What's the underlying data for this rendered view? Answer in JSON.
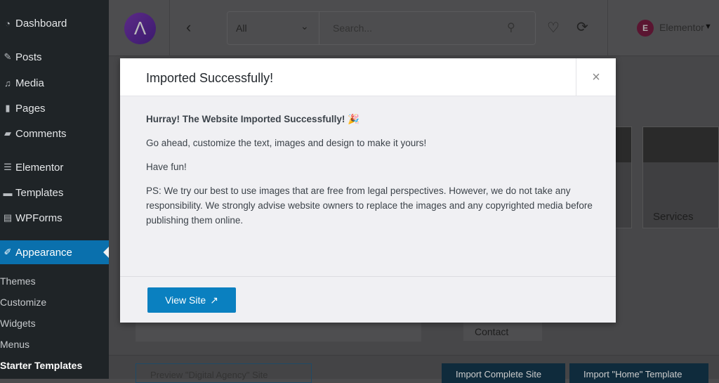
{
  "sidebar": {
    "items": [
      {
        "label": "Dashboard",
        "icon": "dashboard-icon"
      },
      {
        "label": "Posts",
        "icon": "pin-icon"
      },
      {
        "label": "Media",
        "icon": "media-icon"
      },
      {
        "label": "Pages",
        "icon": "pages-icon"
      },
      {
        "label": "Comments",
        "icon": "comment-icon"
      },
      {
        "label": "Elementor",
        "icon": "elementor-icon"
      },
      {
        "label": "Templates",
        "icon": "folder-icon"
      },
      {
        "label": "WPForms",
        "icon": "forms-icon"
      },
      {
        "label": "Appearance",
        "icon": "brush-icon"
      }
    ],
    "submenu": [
      "Themes",
      "Customize",
      "Widgets",
      "Menus",
      "Starter Templates"
    ]
  },
  "topbar": {
    "filter": "All",
    "search_placeholder": "Search...",
    "builder": "Elementor"
  },
  "background": {
    "thumb_label": "Services",
    "contact_label": "Contact",
    "buttons": [
      "Preview \"Digital Agency\" Site",
      "Import Complete Site",
      "Import \"Home\" Template"
    ]
  },
  "modal": {
    "title": "Imported Successfully!",
    "close": "×",
    "heading": "Hurray! The Website Imported Successfully! 🎉",
    "line1": "Go ahead, customize the text, images and design to make it yours!",
    "line2": "Have fun!",
    "line3": "PS: We try our best to use images that are free from legal perspectives. However, we do not take any responsibility. We strongly advise website owners to replace the images and any copyrighted media before publishing them online.",
    "button": "View Site"
  },
  "colors": {
    "accent": "#0a80c0",
    "sidebar_active": "#0a70ad"
  }
}
